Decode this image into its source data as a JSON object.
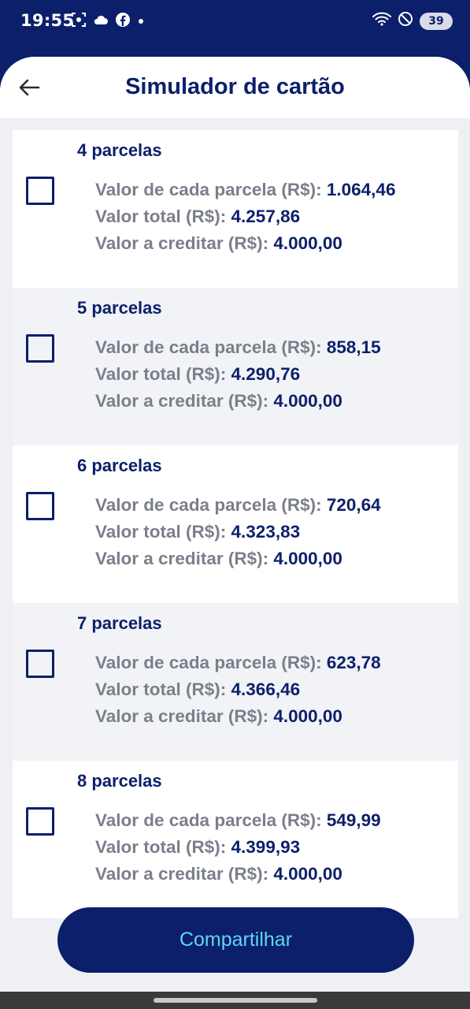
{
  "status_bar": {
    "time": "19:55",
    "battery": "39",
    "left_icons": [
      "screenshot-icon",
      "cloud-icon",
      "facebook-icon",
      "dot-icon"
    ],
    "right_icons": [
      "wifi-icon",
      "do-not-disturb-icon",
      "battery-icon"
    ]
  },
  "header": {
    "title": "Simulador de cartão",
    "back_icon": "arrow-left-icon"
  },
  "labels": {
    "installment_value": "Valor de cada parcela (R$): ",
    "total_value": "Valor total (R$): ",
    "credit_value": "Valor a creditar (R$): "
  },
  "options": [
    {
      "title": "4 parcelas",
      "installment": "1.064,46",
      "total": "4.257,86",
      "credit": "4.000,00",
      "checked": false
    },
    {
      "title": "5 parcelas",
      "installment": "858,15",
      "total": "4.290,76",
      "credit": "4.000,00",
      "checked": false
    },
    {
      "title": "6 parcelas",
      "installment": "720,64",
      "total": "4.323,83",
      "credit": "4.000,00",
      "checked": false
    },
    {
      "title": "7 parcelas",
      "installment": "623,78",
      "total": "4.366,46",
      "credit": "4.000,00",
      "checked": false
    },
    {
      "title": "8 parcelas",
      "installment": "549,99",
      "total": "4.399,93",
      "credit": "4.000,00",
      "checked": false
    }
  ],
  "share_button": {
    "label": "Compartilhar"
  },
  "colors": {
    "primary": "#0c1f6b",
    "button_text": "#5dd8f0",
    "label_gray": "#7b7f8b",
    "background": "#eef0f4"
  }
}
